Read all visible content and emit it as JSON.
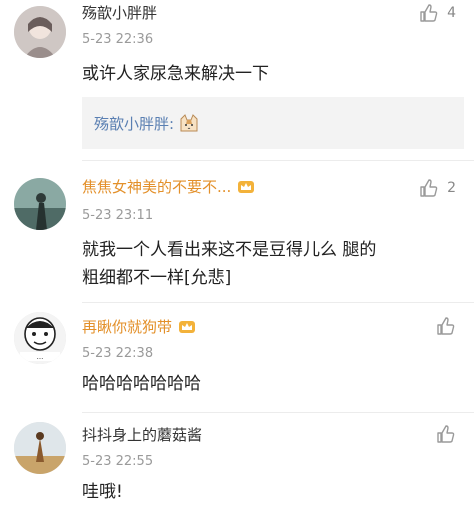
{
  "comments": [
    {
      "username": "殇歆小胖胖",
      "time": "5-23 22:36",
      "text": "或许人家尿急来解决一下",
      "likes": "4",
      "reply": {
        "name": "殇歆小胖胖:"
      }
    },
    {
      "username": "焦焦女神美的不要不...",
      "time": "5-23 23:11",
      "text_line1": "就我一个人看出来这不是豆得儿么  腿的",
      "text_line2": "粗细都不一样[允悲]",
      "likes": "2"
    },
    {
      "username": "再瞅你就狗带",
      "time": "5-23 22:38",
      "text": "哈哈哈哈哈哈哈"
    },
    {
      "username": "抖抖身上的蘑菇酱",
      "time": "5-23 22:55",
      "text": "哇哦!"
    }
  ],
  "colors": {
    "vip_name": "#e3902a",
    "reply_name": "#5a7fb2",
    "meta": "#9a9a9a"
  },
  "icons": [
    "thumbs-up-icon",
    "crown-icon",
    "cat-emoji-icon",
    "avatar-image"
  ]
}
